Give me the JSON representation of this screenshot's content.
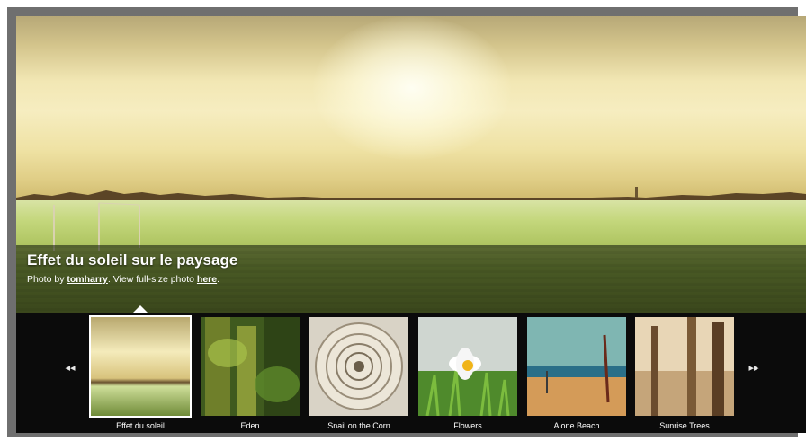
{
  "slideshow": {
    "caption_title": "Effet du soleil sur le paysage",
    "caption_credit": {
      "prefix": "Photo by ",
      "author": "tomharry",
      "middle": ". View full-size photo ",
      "link": "here",
      "suffix": "."
    },
    "nav": {
      "prev": "◂◂",
      "next": "▸▸"
    },
    "thumbnails": [
      {
        "label": "Effet du soleil",
        "active": true
      },
      {
        "label": "Eden",
        "active": false
      },
      {
        "label": "Snail on the Corn",
        "active": false
      },
      {
        "label": "Flowers",
        "active": false
      },
      {
        "label": "Alone Beach",
        "active": false
      },
      {
        "label": "Sunrise Trees",
        "active": false
      }
    ]
  }
}
